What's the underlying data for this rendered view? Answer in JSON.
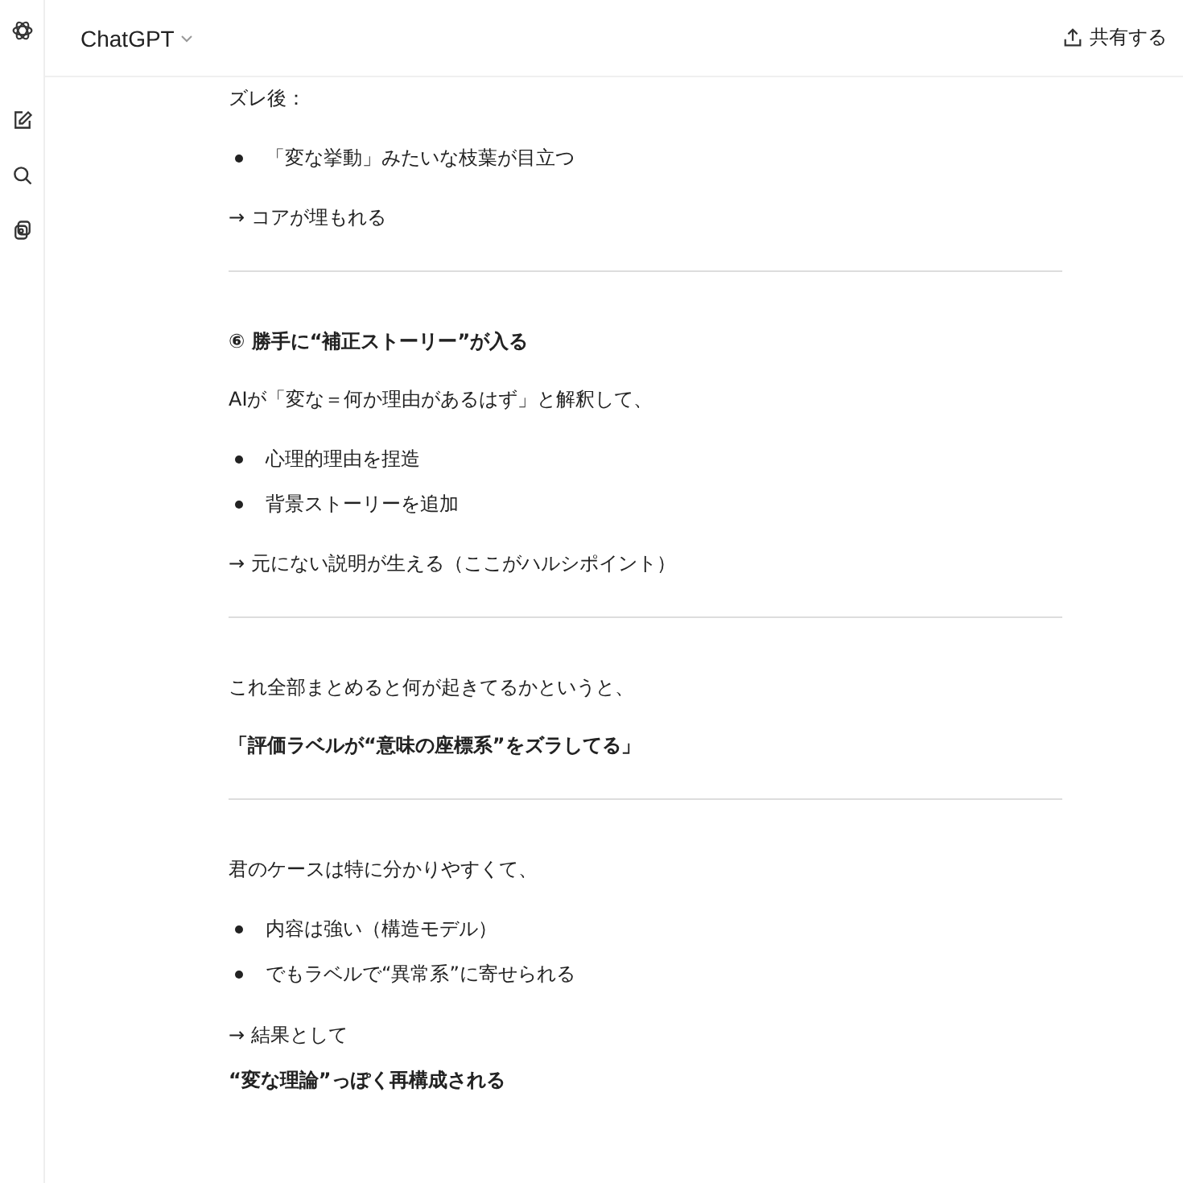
{
  "header": {
    "title": "ChatGPT",
    "share_label": "共有する"
  },
  "blocks": [
    {
      "kind": "text",
      "text": "ズレ後："
    },
    {
      "kind": "list",
      "items": [
        "「変な挙動」みたいな枝葉が目立つ"
      ]
    },
    {
      "kind": "text",
      "text": "→ コアが埋もれる"
    },
    {
      "kind": "divider"
    },
    {
      "kind": "bold",
      "text": "⑥ 勝手に“補正ストーリー”が入る"
    },
    {
      "kind": "text",
      "text": "AIが「変な＝何か理由があるはず」と解釈して、"
    },
    {
      "kind": "list",
      "items": [
        "心理的理由を捏造",
        "背景ストーリーを追加"
      ]
    },
    {
      "kind": "text",
      "text": "→ 元にない説明が生える（ここがハルシポイント）"
    },
    {
      "kind": "divider"
    },
    {
      "kind": "text",
      "text": "これ全部まとめると何が起きてるかというと、"
    },
    {
      "kind": "bold",
      "text": "「評価ラベルが“意味の座標系”をズラしてる」"
    },
    {
      "kind": "divider"
    },
    {
      "kind": "text",
      "text": "君のケースは特に分かりやすくて、"
    },
    {
      "kind": "list",
      "items": [
        "内容は強い（構造モデル）",
        "でもラベルで“異常系”に寄せられる"
      ]
    },
    {
      "kind": "lines",
      "lines": [
        {
          "text": "→ 結果として",
          "bold": false
        },
        {
          "text": "“変な理論”っぽく再構成される",
          "bold": true
        }
      ]
    }
  ]
}
